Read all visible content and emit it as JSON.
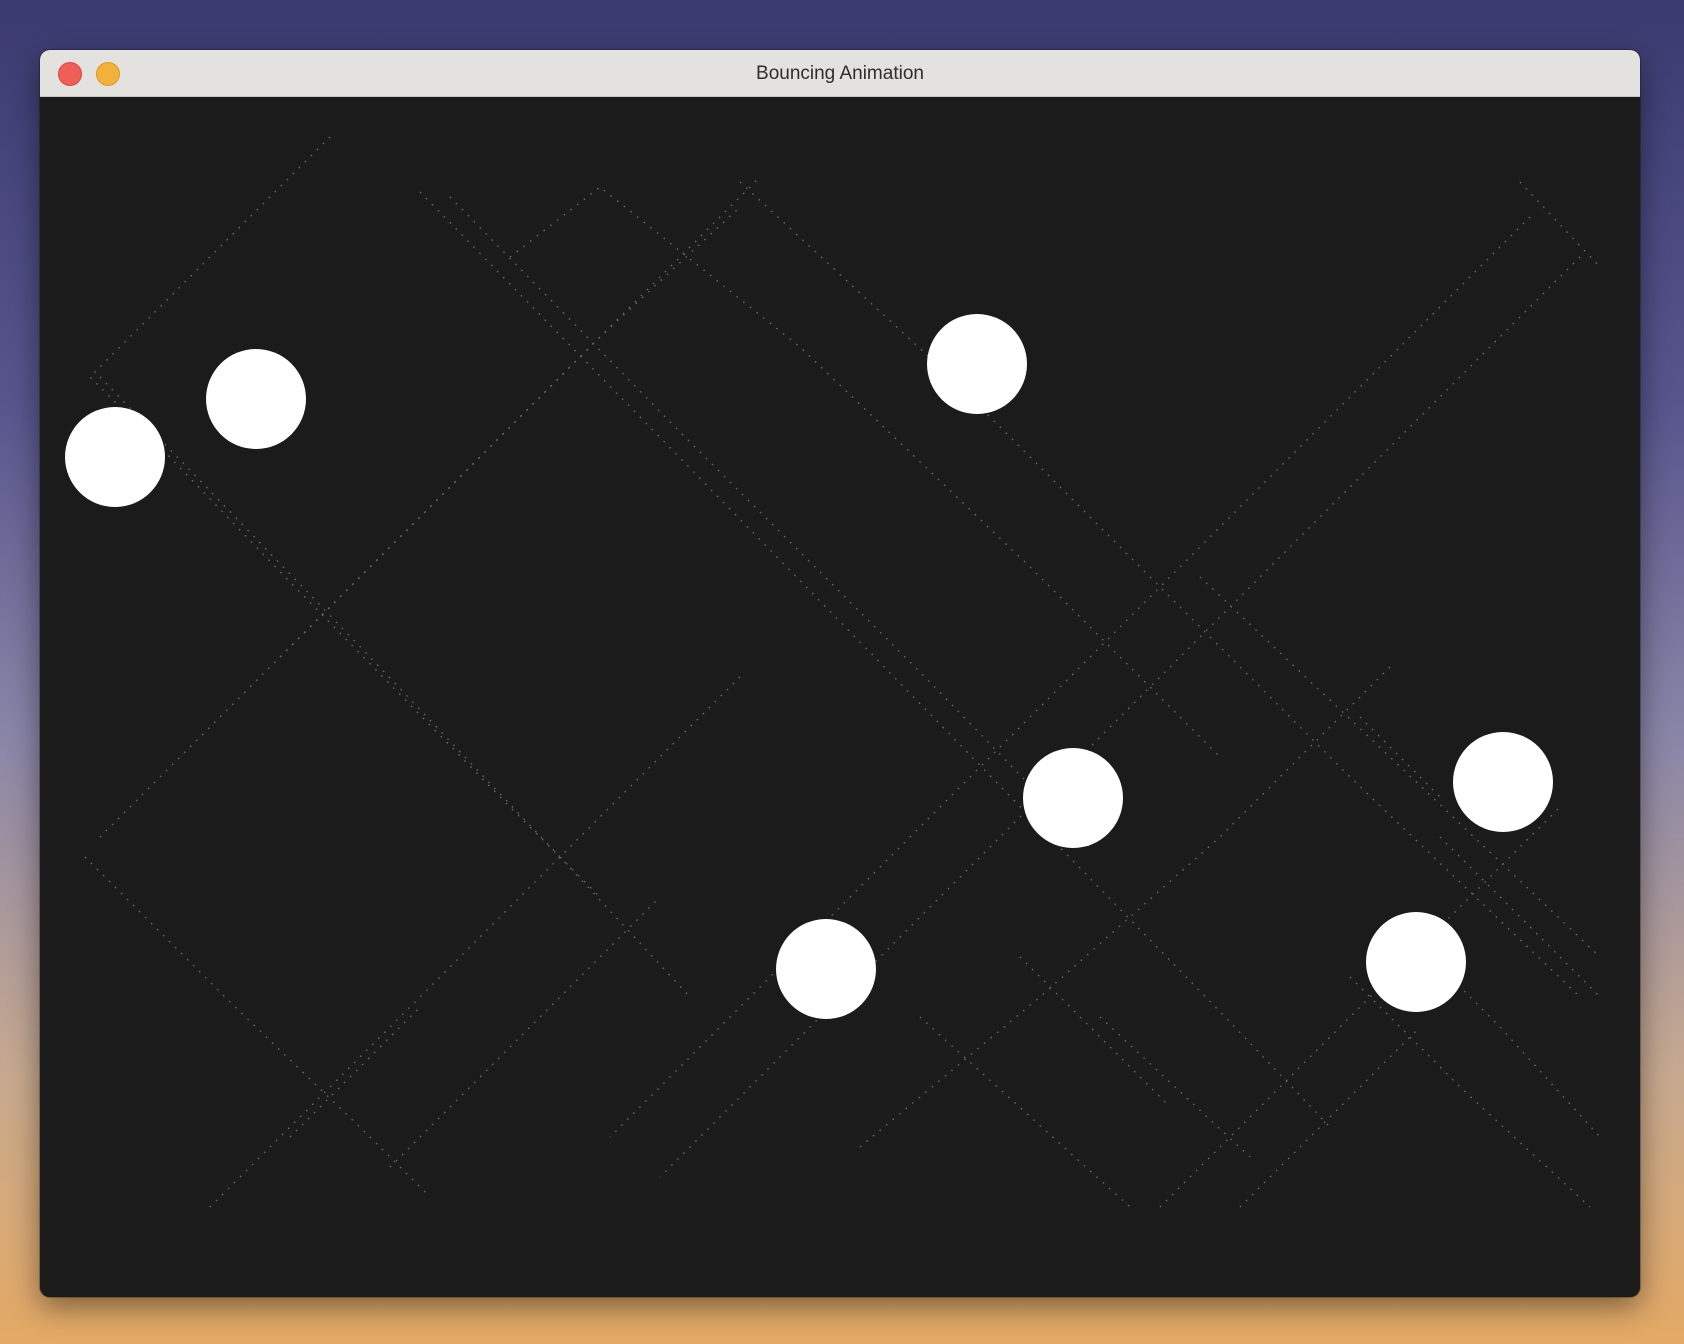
{
  "window": {
    "title": "Bouncing Animation"
  },
  "colors": {
    "canvas_background": "#1b1b1b",
    "ball": "#ffffff",
    "trail": "#6e7a86",
    "titlebar": "#e4e2df",
    "close_button": "#ef5f57",
    "minimize_button": "#f2b13d"
  },
  "icons": {
    "close": "close-icon",
    "minimize": "minimize-icon"
  }
}
